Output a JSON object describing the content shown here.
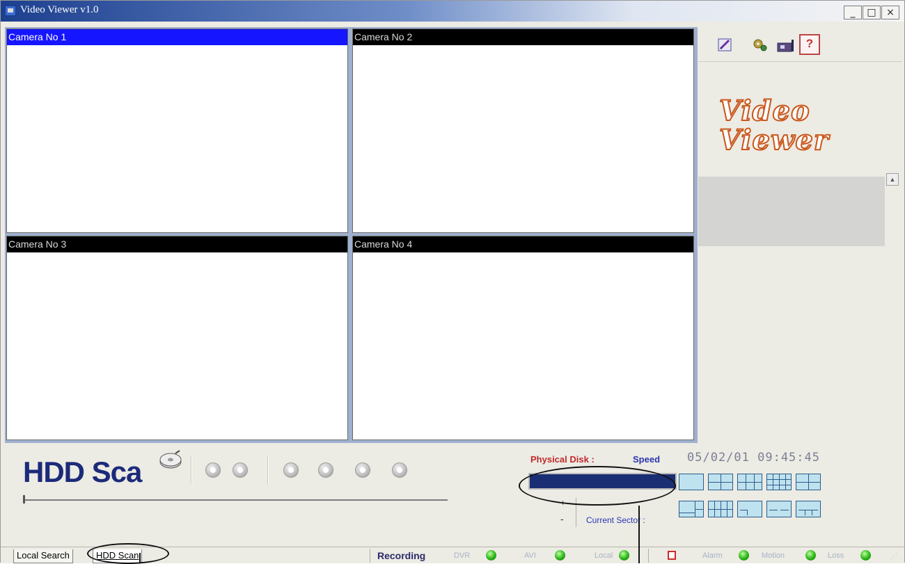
{
  "window": {
    "title": "Video Viewer v1.0",
    "controls": {
      "minimize": "_",
      "maximize": "□",
      "close": "×"
    }
  },
  "cameras": [
    {
      "label": "Camera No 1",
      "active": true
    },
    {
      "label": "Camera No 2",
      "active": false
    },
    {
      "label": "Camera No 3",
      "active": false
    },
    {
      "label": "Camera No 4",
      "active": false
    }
  ],
  "right_panel": {
    "tools": [
      "edit-icon",
      "settings-icon",
      "capture-icon",
      "help-icon"
    ],
    "help_glyph": "?",
    "logo_line1": "Video",
    "logo_line2": "Viewer"
  },
  "controls": {
    "mode_title": "HDD Sca",
    "playback_buttons": [
      "play-icon",
      "stop-icon",
      "rewind-icon",
      "slow-backward-icon",
      "slow-forward-icon",
      "fast-forward-icon"
    ],
    "physical_disk_label": "Physical Disk :",
    "speed_label": "Speed",
    "plus": "+",
    "minus": "-",
    "current_sector_label": "Current Sector :",
    "datetime": "05/02/01  09:45:45"
  },
  "split_layouts": [
    "1",
    "4",
    "6",
    "9",
    "4b",
    "6b",
    "10",
    "pip-1",
    "pip-2",
    "pip-3"
  ],
  "status_bar": {
    "tabs": [
      "Local Search",
      "HDD Scan"
    ],
    "active_tab": "HDD Scan",
    "recording_label": "Recording",
    "indicators": [
      {
        "label": "DVR",
        "color": "#2bb316"
      },
      {
        "label": "AVI",
        "color": "#2bb316"
      },
      {
        "label": "Local",
        "color": "#2bb316"
      },
      {
        "label": "Alarm",
        "color": "#2bb316"
      },
      {
        "label": "Motion",
        "color": "#2bb316"
      },
      {
        "label": "Loss",
        "color": "#2bb316"
      }
    ]
  },
  "colors": {
    "active_camera_header": "#1515ff",
    "camera_header": "#000000",
    "progress_fill": "#1a2f73",
    "logo_stroke": "#c9561a",
    "title_blue": "#1c2a7a"
  }
}
